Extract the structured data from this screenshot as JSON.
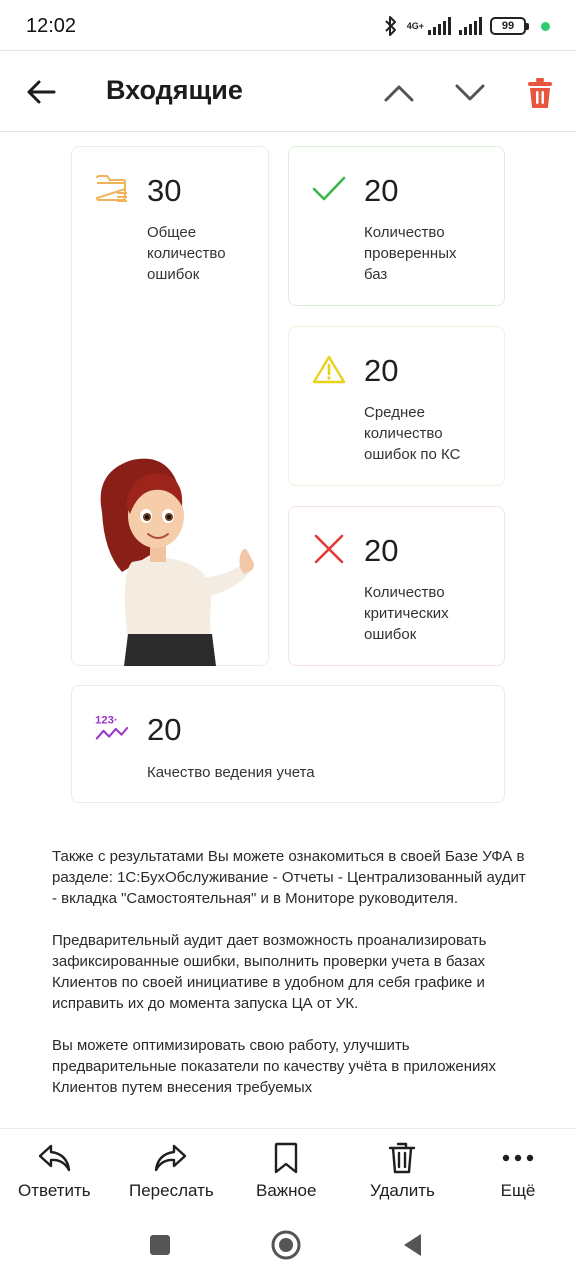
{
  "status": {
    "time": "12:02",
    "network": "4G+",
    "battery": "99"
  },
  "header": {
    "title": "Входящие"
  },
  "cards": {
    "total": {
      "value": "30",
      "label": "Общее\nколичество\nошибок"
    },
    "checked": {
      "value": "20",
      "label": "Количество\nпроверенных\nбаз"
    },
    "average": {
      "value": "20",
      "label": "Среднее\nколичество\nошибок по КС"
    },
    "critical": {
      "value": "20",
      "label": "Количество\nкритических\nошибок"
    },
    "quality": {
      "value": "20",
      "label": "Качество ведения учета",
      "icon_text": "123·"
    }
  },
  "body": {
    "p1": "Также с результатами Вы можете ознакомиться в своей Базе УФА в разделе: 1С:БухОбслуживание - Отчеты - Централизованный аудит - вкладка \"Самостоятельная\" и в Мониторе руководителя.",
    "p2": "Предварительный аудит дает возможность проанализировать зафиксированные ошибки, выполнить проверки учета в базах Клиентов по своей инициативе в удобном для себя графике и исправить их до момента запуска ЦА от УК.",
    "p3": "Вы можете оптимизировать свою работу, улучшить предварительные показатели по качеству учёта в приложениях Клиентов путем внесения требуемых"
  },
  "actions": {
    "reply": "Ответить",
    "forward": "Переслать",
    "important": "Важное",
    "delete": "Удалить",
    "more": "Ещё"
  },
  "colors": {
    "trash": "#e8573d",
    "folder": "#f0b35a",
    "check": "#3cb54a",
    "warning": "#e8d21c",
    "cross": "#e53935",
    "quality": "#9b37c8"
  }
}
